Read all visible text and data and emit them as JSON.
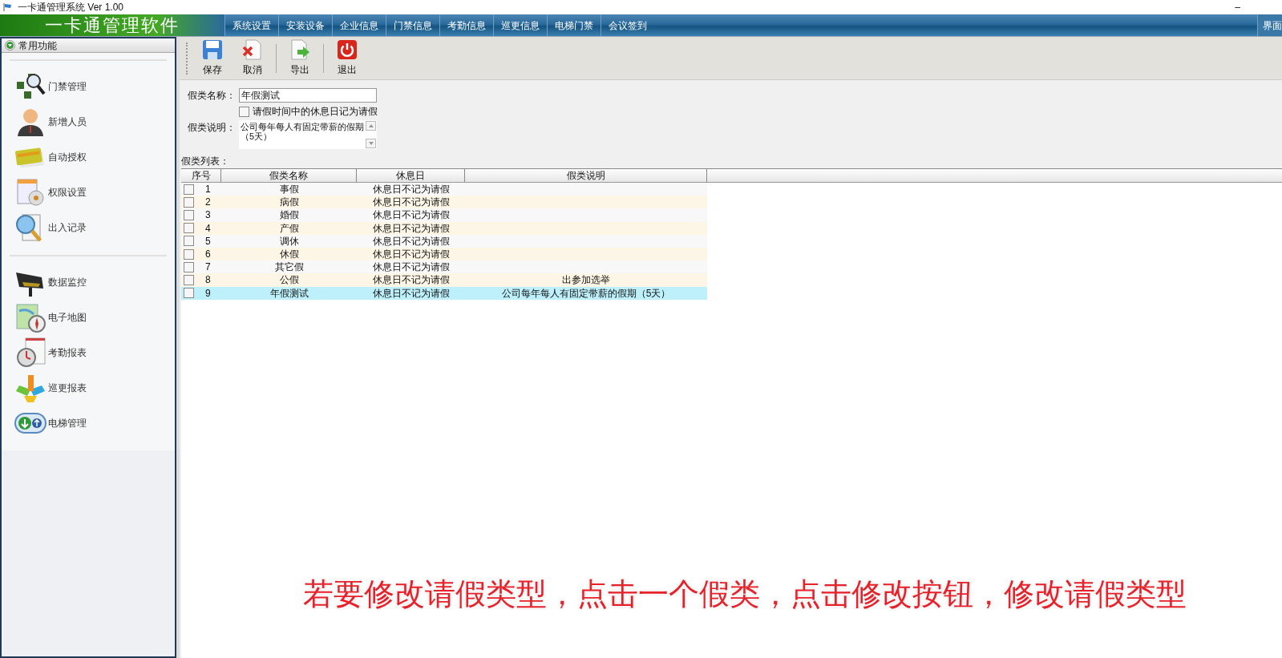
{
  "window": {
    "title": "一卡通管理系统  Ver 1.00",
    "minimize": "–"
  },
  "header": {
    "logo": "一卡通管理软件",
    "menu": [
      "系统设置",
      "安装设备",
      "企业信息",
      "门禁信息",
      "考勤信息",
      "巡更信息",
      "电梯门禁",
      "会议签到"
    ],
    "right_item": "界面"
  },
  "sidebar": {
    "title": "常用功能",
    "groups": [
      {
        "items": [
          "门禁管理",
          "新增人员",
          "自动授权",
          "权限设置",
          "出入记录"
        ]
      },
      {
        "items": [
          "数据监控",
          "电子地图",
          "考勤报表",
          "巡更报表",
          "电梯管理"
        ]
      }
    ]
  },
  "toolbar": {
    "groups": [
      [
        "保存",
        "取消"
      ],
      [
        "导出"
      ],
      [
        "退出"
      ]
    ]
  },
  "form": {
    "name_label": "假类名称：",
    "name_value": "年假测试",
    "checkbox": {
      "label": "请假时间中的休息日记为请假",
      "checked": false
    },
    "desc_label": "假类说明：",
    "desc_value": "公司每年每人有固定带薪的假期（5天）"
  },
  "list_label": "假类列表：",
  "table": {
    "columns": [
      "序号",
      "假类名称",
      "休息日",
      "假类说明"
    ],
    "rows": [
      {
        "no": "1",
        "name": "事假",
        "rest": "休息日不记为请假",
        "desc": "",
        "checked": false,
        "selected": false
      },
      {
        "no": "2",
        "name": "病假",
        "rest": "休息日不记为请假",
        "desc": "",
        "checked": false,
        "selected": false
      },
      {
        "no": "3",
        "name": "婚假",
        "rest": "休息日不记为请假",
        "desc": "",
        "checked": false,
        "selected": false
      },
      {
        "no": "4",
        "name": "产假",
        "rest": "休息日不记为请假",
        "desc": "",
        "checked": false,
        "selected": false
      },
      {
        "no": "5",
        "name": "调休",
        "rest": "休息日不记为请假",
        "desc": "",
        "checked": false,
        "selected": false
      },
      {
        "no": "6",
        "name": "休假",
        "rest": "休息日不记为请假",
        "desc": "",
        "checked": false,
        "selected": false
      },
      {
        "no": "7",
        "name": "其它假",
        "rest": "休息日不记为请假",
        "desc": "",
        "checked": false,
        "selected": false
      },
      {
        "no": "8",
        "name": "公假",
        "rest": "休息日不记为请假",
        "desc": "出参加选举",
        "checked": false,
        "selected": false
      },
      {
        "no": "9",
        "name": "年假测试",
        "rest": "休息日不记为请假",
        "desc": "公司每年每人有固定带薪的假期（5天）",
        "checked": false,
        "selected": true
      }
    ]
  },
  "caption": "若要修改请假类型，点击一个假类，点击修改按钮，修改请假类型"
}
